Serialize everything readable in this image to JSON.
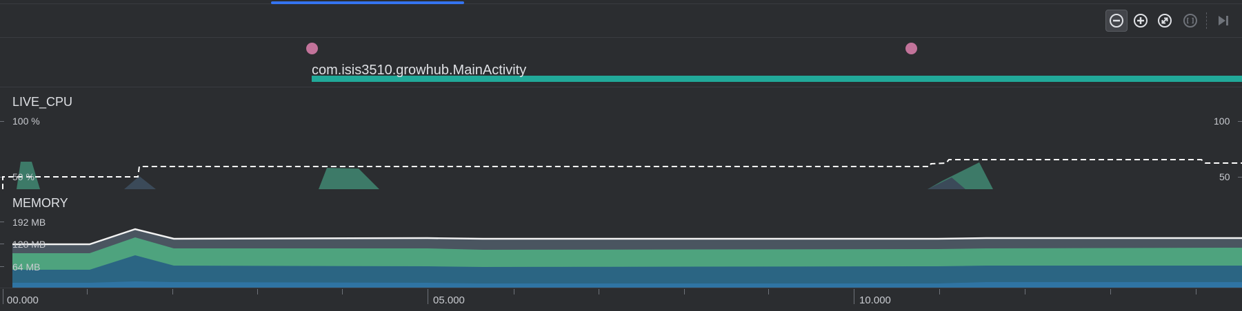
{
  "toolbar": {
    "buttons": [
      {
        "name": "zoom-out",
        "icon": "minus-circle-icon"
      },
      {
        "name": "zoom-in",
        "icon": "plus-circle-icon"
      },
      {
        "name": "reset-zoom",
        "icon": "expand-circle-icon"
      },
      {
        "name": "zoom-to-selection",
        "icon": "selection-icon"
      },
      {
        "name": "attach-to-live",
        "icon": "skip-end-icon"
      }
    ]
  },
  "events": {
    "activity_name": "com.isis3510.growhub.MainActivity",
    "dot_color": "#c2739a",
    "bar_color": "#21a999"
  },
  "cpu": {
    "title": "LIVE_CPU",
    "left_top_label": "100 %",
    "left_mid_label": "50 %",
    "right_top_label": "100",
    "right_mid_label": "50",
    "area_color": "#3d7a68",
    "threads_line_color": "#ffffff"
  },
  "memory": {
    "title": "MEMORY",
    "labels": [
      "192 MB",
      "128 MB",
      "64 MB"
    ],
    "colors": {
      "others": "#4a5560",
      "code": "#4ea37e",
      "java": "#2b6583",
      "native": "#2f74a3",
      "total_line": "#f2f2f2"
    }
  },
  "axis": {
    "labels": [
      "00.000",
      "05.000",
      "10.000"
    ]
  },
  "colors": {
    "background": "#2b2d30",
    "accent": "#3574f0"
  }
}
